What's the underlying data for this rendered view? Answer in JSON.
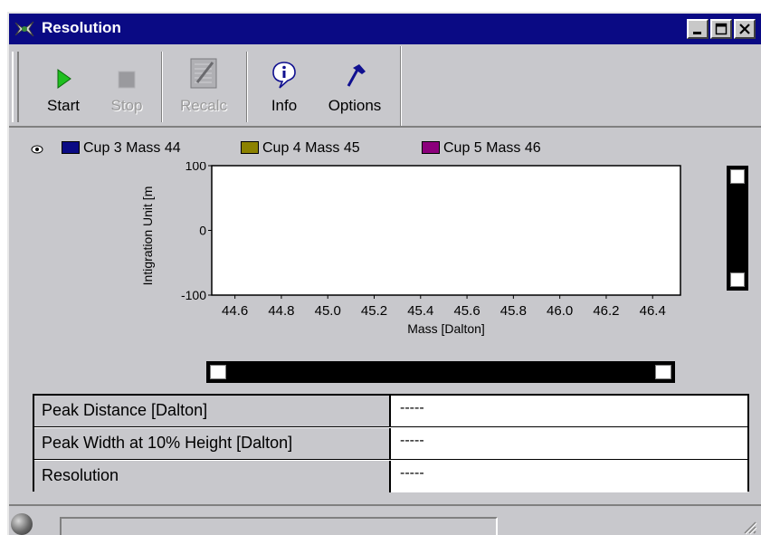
{
  "window": {
    "title": "Resolution"
  },
  "toolbar": {
    "start": "Start",
    "stop": "Stop",
    "recalc": "Recalc",
    "info": "Info",
    "options": "Options"
  },
  "legend": [
    {
      "label": "Cup 3 Mass 44",
      "color": "#0a0a84"
    },
    {
      "label": "Cup 4 Mass 45",
      "color": "#8c8200"
    },
    {
      "label": "Cup 5 Mass 46",
      "color": "#8c007c"
    }
  ],
  "chart_data": {
    "type": "line",
    "xlabel": "Mass [Dalton]",
    "ylabel": "Intigration Unit [m",
    "xlim": [
      44.5,
      46.52
    ],
    "ylim": [
      -100,
      100
    ],
    "xticks": [
      "44.6",
      "44.8",
      "45.0",
      "45.2",
      "45.4",
      "45.6",
      "45.8",
      "46.0",
      "46.2",
      "46.4"
    ],
    "xtick_values": [
      44.6,
      44.8,
      45.0,
      45.2,
      45.4,
      45.6,
      45.8,
      46.0,
      46.2,
      46.4
    ],
    "yticks": [
      "100",
      "0",
      "-100"
    ],
    "ytick_values": [
      100,
      0,
      -100
    ],
    "series": [
      {
        "name": "Cup 3 Mass 44",
        "values": []
      },
      {
        "name": "Cup 4 Mass 45",
        "values": []
      },
      {
        "name": "Cup 5 Mass 46",
        "values": []
      }
    ]
  },
  "results": [
    {
      "label": "Peak Distance [Dalton]",
      "value": "-----"
    },
    {
      "label": "Peak Width at 10% Height [Dalton]",
      "value": "-----"
    },
    {
      "label": "Resolution",
      "value": "-----"
    }
  ],
  "status": {
    "text": ""
  }
}
